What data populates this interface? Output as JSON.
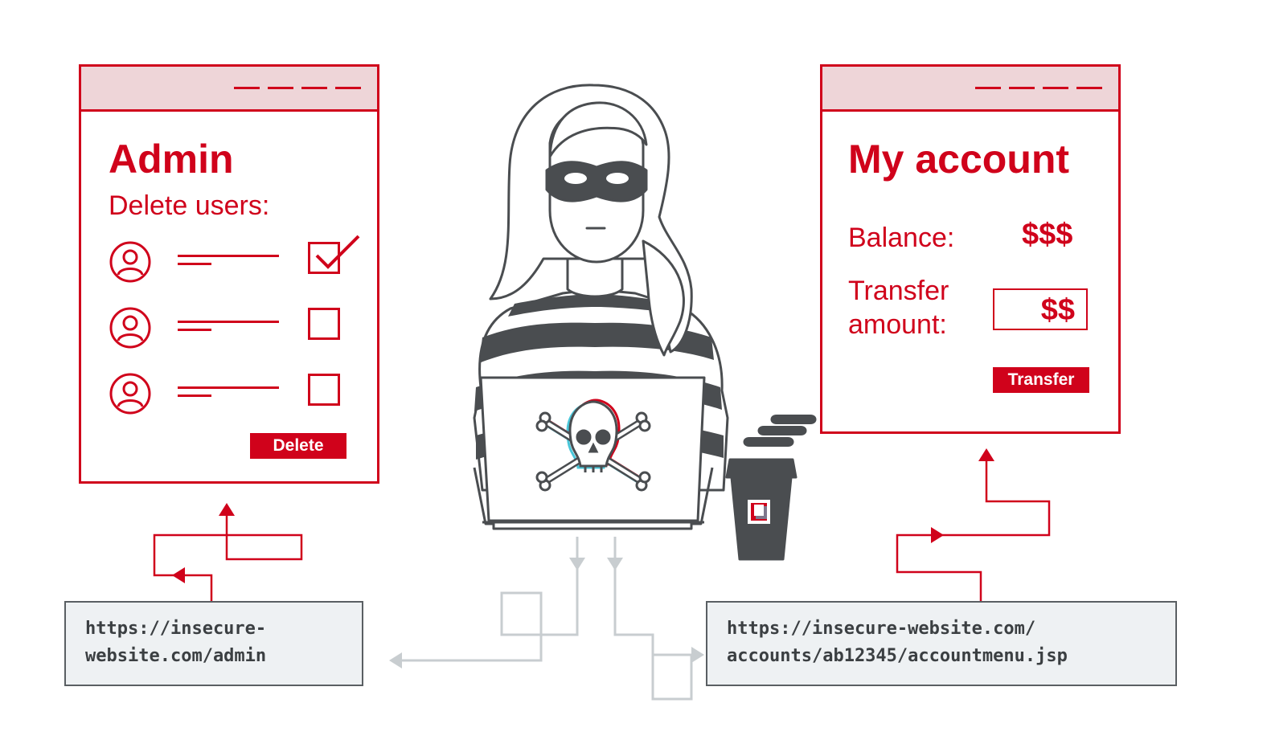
{
  "admin_window": {
    "title": "Admin",
    "subtitle": "Delete users:",
    "users": [
      {
        "icon": "user-icon",
        "checked": true
      },
      {
        "icon": "user-icon",
        "checked": false
      },
      {
        "icon": "user-icon",
        "checked": false
      }
    ],
    "delete_label": "Delete"
  },
  "account_window": {
    "title": "My account",
    "balance_label": "Balance:",
    "balance_value": "$$$",
    "transfer_label_line1": "Transfer",
    "transfer_label_line2": "amount:",
    "transfer_value": "$$",
    "transfer_button": "Transfer"
  },
  "urls": {
    "admin_line1": "https://insecure-",
    "admin_line2": "website.com/admin",
    "account_line1": "https://insecure-website.com/",
    "account_line2": "accounts/ab12345/accountmenu.jsp"
  },
  "colors": {
    "accent": "#d0021b",
    "bar_tint": "#eed5d8",
    "dark": "#4a4d50",
    "url_bg": "#eef1f3",
    "connector_gray": "#c8cdd0"
  },
  "icons": [
    "hacker-icon",
    "laptop-icon",
    "skull-crossbones-icon",
    "coffee-cup-icon",
    "steam-icon",
    "checkmark-icon"
  ]
}
